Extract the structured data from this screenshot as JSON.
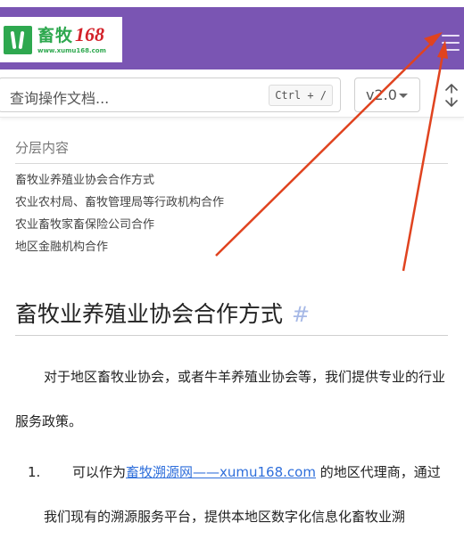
{
  "header": {
    "logo": {
      "cn": "畜牧",
      "num": "168",
      "url": "www.xumu168.com"
    },
    "menu_icon": "hamburger-menu-icon",
    "bg_color": "#7a55b3"
  },
  "search": {
    "placeholder": "查询操作文档...",
    "shortcut": "Ctrl + /",
    "version": "v2.0",
    "expand_icon": "expand-collapse-icon"
  },
  "toc": {
    "title": "分层内容",
    "items": [
      "畜牧业养殖业协会合作方式",
      "农业农村局、畜牧管理局等行政机构合作",
      "农业畜牧家畜保险公司合作",
      "地区金融机构合作"
    ]
  },
  "article": {
    "heading": "畜牧业养殖业协会合作方式",
    "anchor": "#",
    "paragraph": "对于地区畜牧业协会，或者牛羊养殖业协会等，我们提供专业的行业服务政策。",
    "list_item_1": {
      "number": "1.",
      "before": "可以作为",
      "link": "畜牧溯源网——xumu168.com",
      "after": " 的地区代理商，通过我们现有的溯源服务平台，提供本地区数字化信息化畜牧业溯"
    }
  },
  "annotation": {
    "arrow_color": "#e0431f"
  }
}
